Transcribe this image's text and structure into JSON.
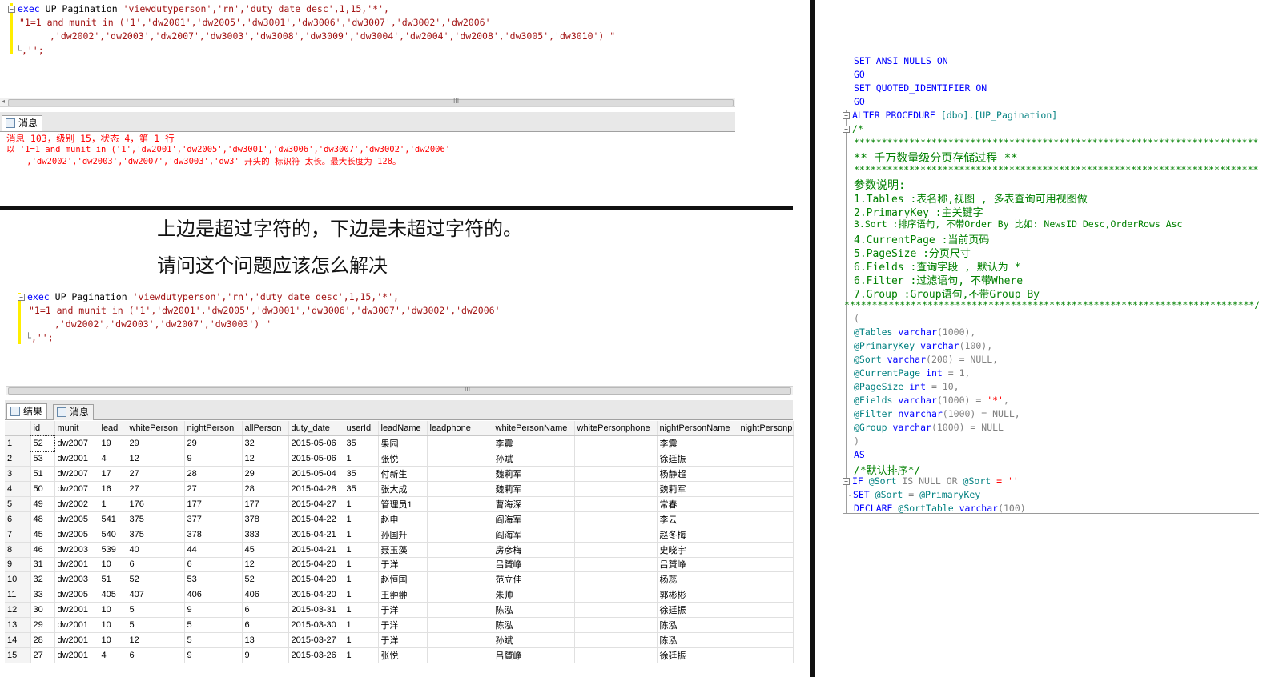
{
  "top_query": {
    "line1": {
      "kw": "exec",
      "proc": "UP_Pagination",
      "args": "'viewdutyperson','rn','duty_date desc',1,15,'*',"
    },
    "line2": "\"1=1 and munit in ('1','dw2001','dw2005','dw3001','dw3006','dw3007','dw3002','dw2006'",
    "line3": ",'dw2002','dw2003','dw2007','dw3003','dw3008','dw3009','dw3004','dw2004','dw2008','dw3005','dw3010') \"",
    "line4": ",'';"
  },
  "messages_tab": {
    "label": "消息"
  },
  "error": {
    "line1": "消息 103，级别 15，状态 4，第 1 行",
    "line2": "以 '1=1 and munit in ('1','dw2001','dw2005','dw3001','dw3006','dw3007','dw3002','dw2006'",
    "line3": "    ,'dw2002','dw2003','dw2007','dw3003','dw3' 开头的 标识符 太长。最大长度为 128。"
  },
  "question": {
    "line1": "上边是超过字符的，下边是未超过字符的。",
    "line2": "请问这个问题应该怎么解决"
  },
  "bottom_query": {
    "line1": {
      "kw": "exec",
      "proc": "UP_Pagination",
      "args": "'viewdutyperson','rn','duty_date desc',1,15,'*',"
    },
    "line2": "\"1=1 and munit in ('1','dw2001','dw2005','dw3001','dw3006','dw3007','dw3002','dw2006'",
    "line3": ",'dw2002','dw2003','dw2007','dw3003') \"",
    "line4": ",'';"
  },
  "result_tabs": {
    "results": "结果",
    "messages": "消息"
  },
  "grid": {
    "columns": [
      "id",
      "munit",
      "lead",
      "whitePerson",
      "nightPerson",
      "allPerson",
      "duty_date",
      "userId",
      "leadName",
      "leadphone",
      "whitePersonName",
      "whitePersonphone",
      "nightPersonName",
      "nightPersonph"
    ],
    "rows": [
      [
        "1",
        "52",
        "dw2007",
        "19",
        "29",
        "29",
        "32",
        "2015-05-06",
        "35",
        "果园",
        "",
        "李震",
        "",
        "李震",
        ""
      ],
      [
        "2",
        "53",
        "dw2001",
        "4",
        "12",
        "9",
        "12",
        "2015-05-06",
        "1",
        "张悦",
        "",
        "孙斌",
        "",
        "徐廷振",
        ""
      ],
      [
        "3",
        "51",
        "dw2007",
        "17",
        "27",
        "28",
        "29",
        "2015-05-04",
        "35",
        "付新生",
        "",
        "魏莉军",
        "",
        "杨静超",
        ""
      ],
      [
        "4",
        "50",
        "dw2007",
        "16",
        "27",
        "27",
        "28",
        "2015-04-28",
        "35",
        "张大成",
        "",
        "魏莉军",
        "",
        "魏莉军",
        ""
      ],
      [
        "5",
        "49",
        "dw2002",
        "1",
        "176",
        "177",
        "177",
        "2015-04-27",
        "1",
        "管理员1",
        "",
        "曹海深",
        "",
        "常春",
        ""
      ],
      [
        "6",
        "48",
        "dw2005",
        "541",
        "375",
        "377",
        "378",
        "2015-04-22",
        "1",
        "赵申",
        "",
        "阎海军",
        "",
        "李云",
        ""
      ],
      [
        "7",
        "45",
        "dw2005",
        "540",
        "375",
        "378",
        "383",
        "2015-04-21",
        "1",
        "孙国升",
        "",
        "阎海军",
        "",
        "赵冬梅",
        ""
      ],
      [
        "8",
        "46",
        "dw2003",
        "539",
        "40",
        "44",
        "45",
        "2015-04-21",
        "1",
        "聂玉藻",
        "",
        "房彦梅",
        "",
        "史晓宇",
        ""
      ],
      [
        "9",
        "31",
        "dw2001",
        "10",
        "6",
        "6",
        "12",
        "2015-04-20",
        "1",
        "于洋",
        "",
        "吕贇峥",
        "",
        "吕贇峥",
        ""
      ],
      [
        "10",
        "32",
        "dw2003",
        "51",
        "52",
        "53",
        "52",
        "2015-04-20",
        "1",
        "赵恒国",
        "",
        "范立佳",
        "",
        "杨蕊",
        ""
      ],
      [
        "11",
        "33",
        "dw2005",
        "405",
        "407",
        "406",
        "406",
        "2015-04-20",
        "1",
        "王翀翀",
        "",
        "朱帅",
        "",
        "郭彬彬",
        ""
      ],
      [
        "12",
        "30",
        "dw2001",
        "10",
        "5",
        "9",
        "6",
        "2015-03-31",
        "1",
        "于洋",
        "",
        "陈泓",
        "",
        "徐廷振",
        ""
      ],
      [
        "13",
        "29",
        "dw2001",
        "10",
        "5",
        "5",
        "6",
        "2015-03-30",
        "1",
        "于洋",
        "",
        "陈泓",
        "",
        "陈泓",
        ""
      ],
      [
        "14",
        "28",
        "dw2001",
        "10",
        "12",
        "5",
        "13",
        "2015-03-27",
        "1",
        "于洋",
        "",
        "孙斌",
        "",
        "陈泓",
        ""
      ],
      [
        "15",
        "27",
        "dw2001",
        "4",
        "6",
        "9",
        "9",
        "2015-03-26",
        "1",
        "张悦",
        "",
        "吕贇峥",
        "",
        "徐廷振",
        ""
      ]
    ]
  },
  "sp_code": {
    "l1": "SET ANSI_NULLS ON",
    "l2": "GO",
    "l3": "SET QUOTED_IDENTIFIER ON",
    "l4": "GO",
    "l5a": "ALTER PROCEDURE",
    "l5b": "[dbo].[UP_Pagination]",
    "l6": "/*",
    "l7": "**************************************************************************",
    "l8": "** 千万数量级分页存储过程 **",
    "l9": "**************************************************************************",
    "l10": "参数说明:",
    "l11": "1.Tables :表名称,视图 , 多表查询可用视图做",
    "l12": "2.PrimaryKey :主关键字",
    "l13": "3.Sort :排序语句, 不带Order By 比如: NewsID Desc,OrderRows Asc",
    "l14": "4.CurrentPage :当前页码",
    "l15": "5.PageSize :分页尺寸",
    "l16": "6.Fields :查询字段 , 默认为 *",
    "l17": "6.Filter :过滤语句, 不带Where",
    "l18": "7.Group :Group语句,不带Group By",
    "l19": "**************************************************************************/",
    "l20": "(",
    "p1": {
      "name": "@Tables",
      "type": "varchar",
      "rest": "(1000),"
    },
    "p2": {
      "name": "@PrimaryKey",
      "type": "varchar",
      "rest": "(100),"
    },
    "p3": {
      "name": "@Sort",
      "type": "varchar",
      "rest": "(200) = NULL,"
    },
    "p4": {
      "name": "@CurrentPage",
      "type": "int",
      "rest": " = 1,"
    },
    "p5": {
      "name": "@PageSize",
      "type": "int",
      "rest": " = 10,"
    },
    "p6": {
      "name": "@Fields",
      "type": "varchar",
      "rest": "(1000) = ",
      "val": "'*'",
      "tail": ","
    },
    "p7": {
      "name": "@Filter",
      "type": "nvarchar",
      "rest": "(1000) = NULL,"
    },
    "p8": {
      "name": "@Group",
      "type": "varchar",
      "rest": "(1000) = NULL"
    },
    "l29": ")",
    "l30": "AS",
    "l31": "/*默认排序*/",
    "l32a": "IF",
    "l32b": "@Sort",
    "l32c": "IS NULL OR",
    "l32d": "@Sort",
    "l32e": "= ''",
    "l33a": "SET",
    "l33b": "@Sort",
    "l33c": "=",
    "l33d": "@PrimaryKey",
    "l34a": "DECLARE",
    "l34b": "@SortTable",
    "l34c": "varchar",
    "l34d": "(100)"
  }
}
